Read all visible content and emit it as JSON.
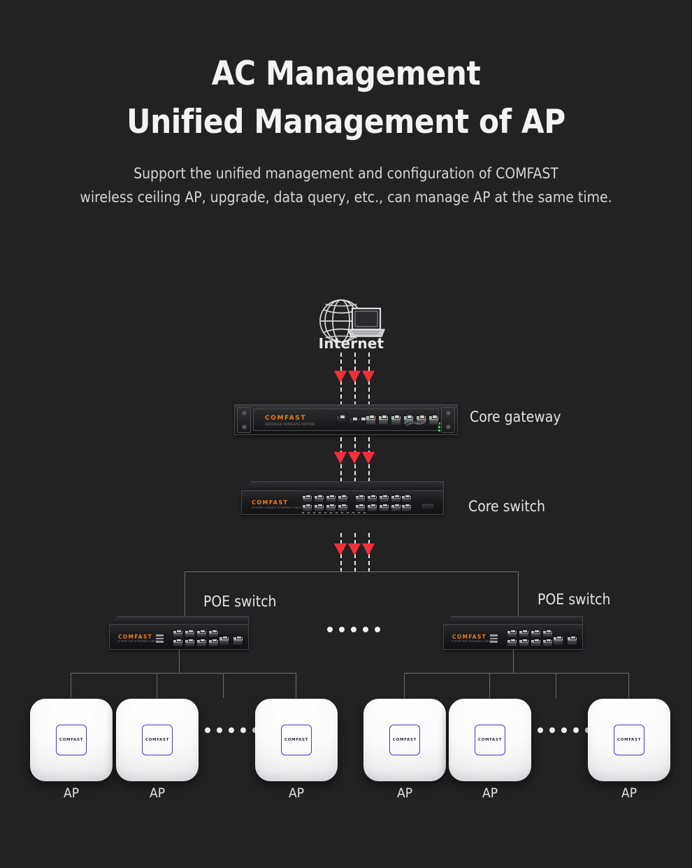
{
  "header": {
    "title_line1": "AC Management",
    "title_line2": "Unified Management of AP",
    "subtitle_line1": "Support the unified management and configuration of COMFAST",
    "subtitle_line2": "wireless ceiling AP, upgrade, data query, etc., can manage AP at the same time."
  },
  "colors": {
    "background": "#222222",
    "title_text": "#f3f3f3",
    "body_text": "#d6d6d6",
    "brand_orange": "#f07c1e",
    "arrow_red": "#f0303c",
    "ap_accent_blue": "#3c3cc8",
    "connector_gray": "#6e6e71"
  },
  "topology": {
    "internet": {
      "label": "Internet",
      "icon": "globe-laptop-icon"
    },
    "gateway": {
      "label": "Core gateway",
      "brand": "COMFAST",
      "model_line": "ADVANCED WIRELESS ROUTER"
    },
    "core_switch": {
      "label": "Core switch",
      "brand": "COMFAST",
      "model_line": "16 PORT GIGABIT ETHERNET SWITCH"
    },
    "poe_switches": [
      {
        "label": "POE switch",
        "brand": "COMFAST",
        "model_line": "8 PORT POE ETHERNET SWITCH"
      },
      {
        "label": "POE switch",
        "brand": "COMFAST",
        "model_line": "8 PORT POE ETHERNET SWITCH"
      }
    ],
    "access_points": [
      {
        "label": "AP",
        "brand": "COMFAST"
      },
      {
        "label": "AP",
        "brand": "COMFAST"
      },
      {
        "label": "AP",
        "brand": "COMFAST"
      },
      {
        "label": "AP",
        "brand": "COMFAST"
      },
      {
        "label": "AP",
        "brand": "COMFAST"
      },
      {
        "label": "AP",
        "brand": "COMFAST"
      }
    ],
    "ellipsis_dot_count": 5
  }
}
